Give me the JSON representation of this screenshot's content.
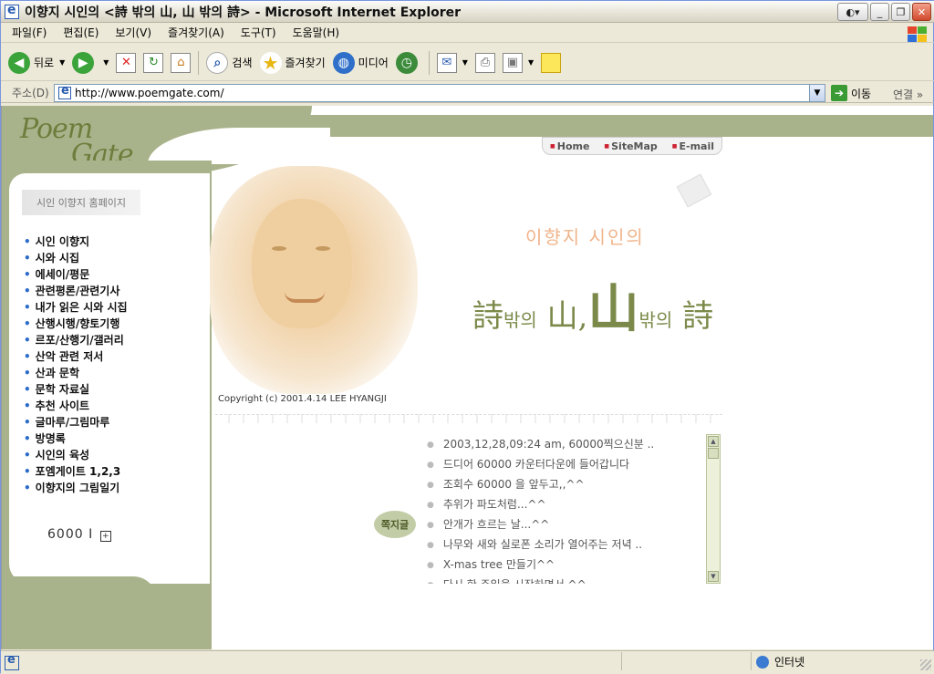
{
  "window": {
    "title": "이향지 시인의 <詩 밖의 山, 山 밖의 詩> - Microsoft Internet Explorer"
  },
  "menubar": [
    "파일(F)",
    "편집(E)",
    "보기(V)",
    "즐겨찾기(A)",
    "도구(T)",
    "도움말(H)"
  ],
  "toolbar": {
    "back": "뒤로",
    "search": "검색",
    "favorites": "즐겨찾기",
    "media": "미디어"
  },
  "address": {
    "label": "주소(D)",
    "url": "http://www.poemgate.com/",
    "go": "이동",
    "links": "연결"
  },
  "site": {
    "logo_line1": "Poem",
    "logo_line2": "Gate",
    "nav": [
      "Home",
      "SiteMap",
      "E-mail"
    ],
    "sidebar_title": "시인 이향지 홈페이지",
    "menu": [
      "시인 이향지",
      "시와 시집",
      "에세이/평문",
      "관련평론/관련기사",
      "내가 읽은 시와 시집",
      "산행시행/향토기행",
      "르포/산행기/갤러리",
      "산악 관련 저서",
      "산과 문학",
      "문학 자료실",
      "추천 사이트",
      "글마루/그림마루",
      "방명록",
      "시인의 육성",
      "포엠게이트 1,2,3",
      "이향지의 그림일기"
    ],
    "counter": "6000 I",
    "copyright": "Copyright (c) 2001.4.14   LEE HYANGJI",
    "poet_label": "이향지  시인의",
    "poem_title_a": "詩",
    "poem_title_b": "밖의",
    "poem_title_c": "山,",
    "poem_title_d": "山",
    "poem_title_e": "밖의",
    "poem_title_f": "詩",
    "notes_badge": "쪽지글",
    "notes": [
      "2003,12,28,09:24 am, 60000찍으신분 ..",
      "드디어 60000 카운터다운에 들어갑니다",
      "조회수 60000 을 앞두고,,^^",
      "추위가 파도처럼...^^",
      "안개가 흐르는 날...^^",
      "나무와 새와 실로폰 소리가 열어주는 저녁 ..",
      "X-mas tree 만들기^^",
      "다시 한 주일을 시작하면서 ^^"
    ]
  },
  "status": {
    "zone": "인터넷"
  }
}
